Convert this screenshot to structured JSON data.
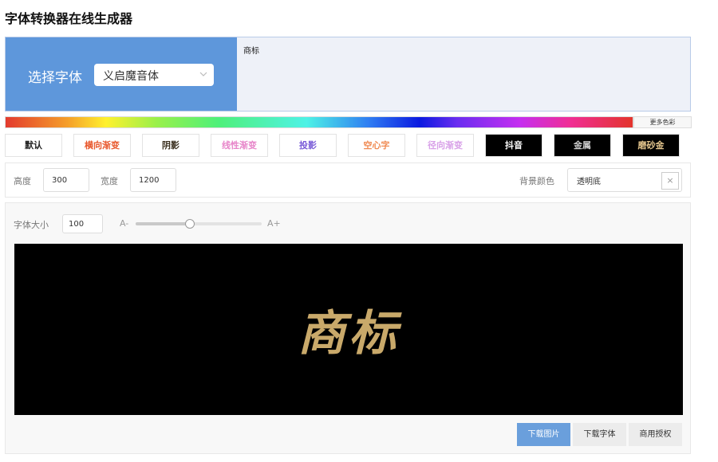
{
  "page_title": "字体转换器在线生成器",
  "font_select": {
    "label": "选择字体",
    "value": "义启魔音体",
    "icon": "chevron-down-icon"
  },
  "text_input": {
    "value": "商标"
  },
  "color_bar": {
    "more_label": "更多色彩"
  },
  "styles": [
    {
      "label": "默认",
      "color": "#222222",
      "bg": "#ffffff"
    },
    {
      "label": "横向渐变",
      "color": "#e8572b",
      "bg": "#ffffff"
    },
    {
      "label": "阴影",
      "color": "#3a2f1e",
      "bg": "#ffffff"
    },
    {
      "label": "线性渐变",
      "color": "#e784c9",
      "bg": "#ffffff"
    },
    {
      "label": "投影",
      "color": "#7a5cd8",
      "bg": "#ffffff"
    },
    {
      "label": "空心字",
      "color": "#f08a52",
      "bg": "#ffffff"
    },
    {
      "label": "径向渐变",
      "color": "#d8a0e8",
      "bg": "#ffffff"
    },
    {
      "label": "抖音",
      "color": "#ffffff",
      "bg": "#000000"
    },
    {
      "label": "金属",
      "color": "#cccccc",
      "bg": "#000000"
    },
    {
      "label": "磨砂金",
      "color": "#e2c48c",
      "bg": "#000000"
    }
  ],
  "size": {
    "height_label": "高度",
    "height_value": "300",
    "width_label": "宽度",
    "width_value": "1200",
    "bg_label": "背景颜色",
    "bg_value": "透明底",
    "clear_symbol": "×"
  },
  "font_size": {
    "label": "字体大小",
    "value": "100",
    "minus_label": "A-",
    "plus_label": "A+",
    "slider_fraction": 0.43
  },
  "preview": {
    "text": "商标",
    "text_color": "#c9a96a",
    "bg_color": "#000000"
  },
  "actions": {
    "download_image": "下载图片",
    "download_font": "下载字体",
    "commercial_license": "商用授权"
  },
  "colors": {
    "accent": "#5e97db",
    "primary_button": "#6a9fdc"
  }
}
